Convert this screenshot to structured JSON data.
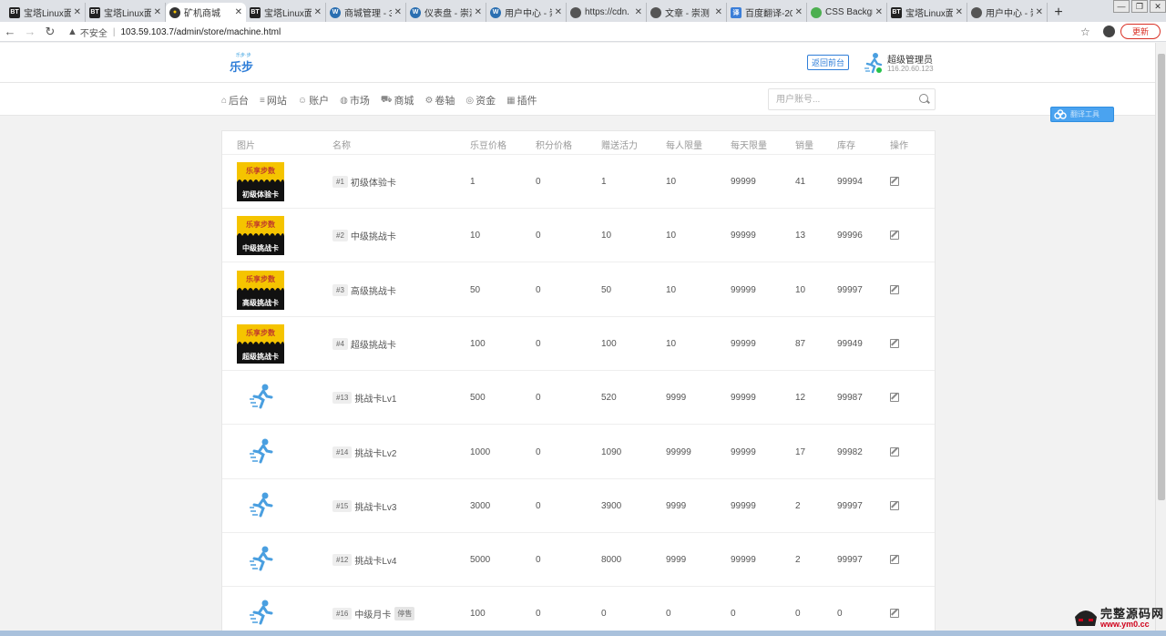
{
  "browser": {
    "tabs": [
      {
        "favicon": "bt-icon",
        "title": "宝塔Linux面"
      },
      {
        "favicon": "bt-icon",
        "title": "宝塔Linux面"
      },
      {
        "favicon": "ore-icon",
        "title": "矿机商城",
        "active": true
      },
      {
        "favicon": "bt-icon",
        "title": "宝塔Linux面"
      },
      {
        "favicon": "wordpress-icon",
        "title": "商城管理 - 3"
      },
      {
        "favicon": "wordpress-icon",
        "title": "仪表盘 - 崇润"
      },
      {
        "favicon": "wordpress-icon",
        "title": "用户中心 - 崇"
      },
      {
        "favicon": "globe-icon",
        "title": "https://cdn."
      },
      {
        "favicon": "globe-icon",
        "title": "文章 - 崇测"
      },
      {
        "favicon": "baidu-translate-icon",
        "title": "百度翻译-20"
      },
      {
        "favicon": "css-icon",
        "title": "CSS Backgr"
      },
      {
        "favicon": "bt-icon",
        "title": "宝塔Linux面"
      },
      {
        "favicon": "globe-icon",
        "title": "用户中心 - 崇"
      }
    ],
    "new_tab": "+",
    "insecure_label": "不安全",
    "url": "103.59.103.7/admin/store/machine.html",
    "update_label": "更新"
  },
  "header": {
    "logo_small": "乐步·步",
    "logo_text": "乐步",
    "back_label": "返回前台",
    "admin_name": "超级管理员",
    "admin_ip": "116.20.60.123"
  },
  "menu": {
    "items": [
      {
        "icon": "home-icon",
        "glyph": "⌂",
        "label": "后台"
      },
      {
        "icon": "list-icon",
        "glyph": "≡",
        "label": "网站"
      },
      {
        "icon": "users-icon",
        "glyph": "☺",
        "label": "账户"
      },
      {
        "icon": "globe-icon",
        "glyph": "◍",
        "label": "市场"
      },
      {
        "icon": "cart-icon",
        "glyph": "⛟",
        "label": "商城"
      },
      {
        "icon": "gear-icon",
        "glyph": "⚙",
        "label": "卷轴"
      },
      {
        "icon": "coin-icon",
        "glyph": "◎",
        "label": "资金"
      },
      {
        "icon": "grid-icon",
        "glyph": "▦",
        "label": "插件"
      }
    ],
    "search_placeholder": "用户账号..."
  },
  "float_button": {
    "label": "翻译工具"
  },
  "table": {
    "headers": [
      "图片",
      "名称",
      "乐豆价格",
      "积分价格",
      "赠送活力",
      "每人限量",
      "每天限量",
      "销量",
      "库存",
      "操作"
    ],
    "rows": [
      {
        "image": "card",
        "thumb_top": "乐享步数",
        "thumb_label": "初级体验卡",
        "id": "#1",
        "name": "初级体验卡",
        "tag": "",
        "price_bean": "1",
        "price_points": "0",
        "vitality": "1",
        "per_user": "10",
        "per_day": "99999",
        "sales": "41",
        "stock": "99994"
      },
      {
        "image": "card",
        "thumb_top": "乐享步数",
        "thumb_label": "中级挑战卡",
        "id": "#2",
        "name": "中级挑战卡",
        "tag": "",
        "price_bean": "10",
        "price_points": "0",
        "vitality": "10",
        "per_user": "10",
        "per_day": "99999",
        "sales": "13",
        "stock": "99996"
      },
      {
        "image": "card",
        "thumb_top": "乐享步数",
        "thumb_label": "高级挑战卡",
        "id": "#3",
        "name": "高级挑战卡",
        "tag": "",
        "price_bean": "50",
        "price_points": "0",
        "vitality": "50",
        "per_user": "10",
        "per_day": "99999",
        "sales": "10",
        "stock": "99997"
      },
      {
        "image": "card",
        "thumb_top": "乐享步数",
        "thumb_label": "超级挑战卡",
        "id": "#4",
        "name": "超级挑战卡",
        "tag": "",
        "price_bean": "100",
        "price_points": "0",
        "vitality": "100",
        "per_user": "10",
        "per_day": "99999",
        "sales": "87",
        "stock": "99949"
      },
      {
        "image": "runner",
        "id": "#13",
        "name": "挑战卡Lv1",
        "tag": "",
        "price_bean": "500",
        "price_points": "0",
        "vitality": "520",
        "per_user": "9999",
        "per_day": "99999",
        "sales": "12",
        "stock": "99987"
      },
      {
        "image": "runner",
        "id": "#14",
        "name": "挑战卡Lv2",
        "tag": "",
        "price_bean": "1000",
        "price_points": "0",
        "vitality": "1090",
        "per_user": "99999",
        "per_day": "99999",
        "sales": "17",
        "stock": "99982"
      },
      {
        "image": "runner",
        "id": "#15",
        "name": "挑战卡Lv3",
        "tag": "",
        "price_bean": "3000",
        "price_points": "0",
        "vitality": "3900",
        "per_user": "9999",
        "per_day": "99999",
        "sales": "2",
        "stock": "99997"
      },
      {
        "image": "runner",
        "id": "#12",
        "name": "挑战卡Lv4",
        "tag": "",
        "price_bean": "5000",
        "price_points": "0",
        "vitality": "8000",
        "per_user": "9999",
        "per_day": "99999",
        "sales": "2",
        "stock": "99997"
      },
      {
        "image": "runner",
        "id": "#16",
        "name": "中级月卡",
        "tag": "停售",
        "price_bean": "100",
        "price_points": "0",
        "vitality": "0",
        "per_user": "0",
        "per_day": "0",
        "sales": "0",
        "stock": "0"
      }
    ]
  },
  "watermark": {
    "title": "完整源码网",
    "url": "www.ym0.cc"
  },
  "colors": {
    "accent": "#2f7ed8",
    "card_yellow": "#f5c400",
    "online": "#27c24c",
    "update": "#d93025"
  }
}
